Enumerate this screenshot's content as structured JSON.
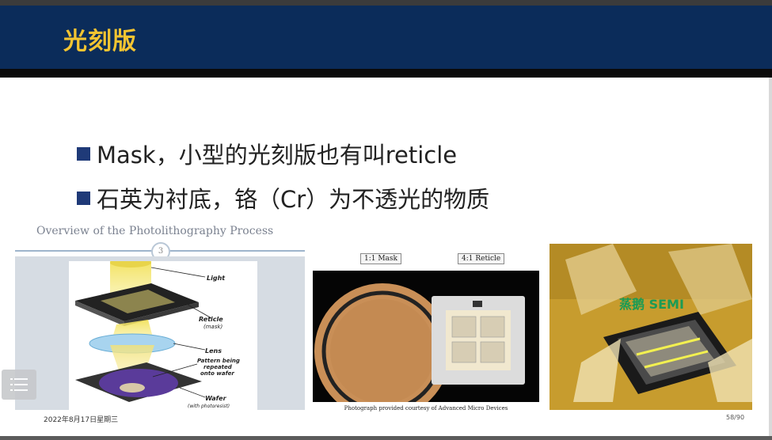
{
  "slide": {
    "title": "光刻版",
    "bullets": [
      "Mask，小型的光刻版也有叫reticle",
      "石英为衬底，铬（Cr）为不透光的物质"
    ]
  },
  "figure_left": {
    "title": "Overview of the Photolithography Process",
    "step_number": "3",
    "labels": {
      "light": "Light",
      "reticle": "Reticle",
      "mask_note": "(mask)",
      "lens": "Lens",
      "pattern_line1": "Pattern being",
      "pattern_line2": "repeated",
      "pattern_line3": "onto wafer",
      "wafer": "Wafer",
      "wafer_note": "(with photoresist)"
    }
  },
  "figure_middle": {
    "label_mask": "1:1 Mask",
    "label_reticle": "4:1 Reticle",
    "credit": "Photograph provided courtesy of Advanced Micro Devices"
  },
  "figure_right": {
    "watermark": "蒸鹅 SEMI"
  },
  "footer": {
    "date": "2022年8月17日星期三",
    "page": "58/90"
  },
  "colors": {
    "header_bg": "#0b2c5a",
    "title_color": "#f3c431",
    "bullet_square": "#1f3a78"
  },
  "icons": {
    "menu": "list-menu-icon"
  }
}
